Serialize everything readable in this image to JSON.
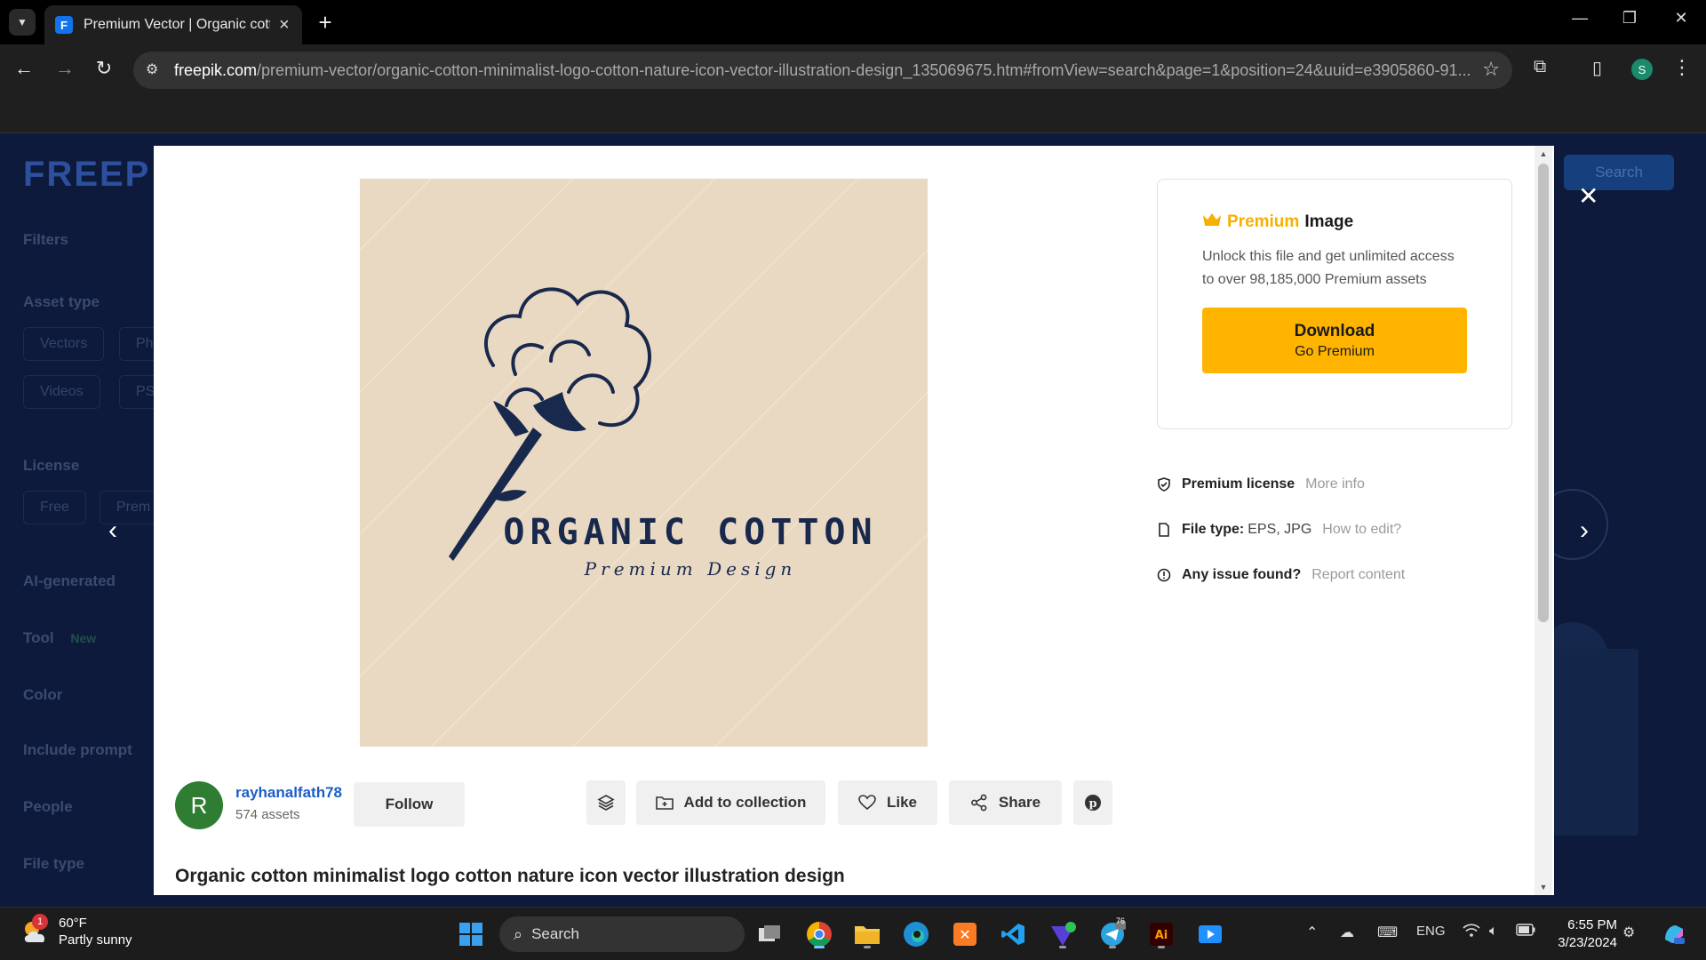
{
  "browser": {
    "tab_title": "Premium Vector | Organic cotto",
    "url_host": "freepik.com",
    "url_path": "/premium-vector/organic-cotton-minimalist-logo-cotton-nature-icon-vector-illustration-design_135069675.htm#fromView=search&page=1&position=24&uuid=e3905860-91...",
    "profile_initial": "S"
  },
  "background_page": {
    "logo": "FREEP",
    "search_label": "Search",
    "filters": "Filters",
    "asset_type": "Asset type",
    "chips_type": [
      "Vectors",
      "Ph",
      "Videos",
      "PS"
    ],
    "license": "License",
    "chips_license": [
      "Free",
      "Prem"
    ],
    "ai_generated": "AI-generated",
    "tool": "Tool",
    "tool_badge": "New",
    "color": "Color",
    "include_prompt": "Include prompt",
    "people": "People",
    "file_type": "File type"
  },
  "preview": {
    "logo_main": "ORGANIC COTTON",
    "logo_sub": "Premium Design"
  },
  "premium_card": {
    "badge": "Premium",
    "label": "Image",
    "description": "Unlock this file and get unlimited access to over 98,185,000 Premium assets",
    "download_title": "Download",
    "download_sub": "Go Premium"
  },
  "info": {
    "license_label": "Premium license",
    "license_link": "More info",
    "filetype_label": "File type:",
    "filetype_value": "EPS, JPG",
    "filetype_link": "How to edit?",
    "issue_label": "Any issue found?",
    "issue_link": "Report content"
  },
  "author": {
    "initial": "R",
    "name": "rayhanalfath78",
    "assets": "574 assets",
    "follow": "Follow"
  },
  "actions": {
    "add_to_collection": "Add to collection",
    "like": "Like",
    "share": "Share"
  },
  "asset_title": "Organic cotton minimalist logo cotton nature icon vector illustration design",
  "taskbar": {
    "temperature": "60°F",
    "condition": "Partly sunny",
    "weather_badge": "1",
    "search_placeholder": "Search",
    "language": "ENG",
    "time": "6:55 PM",
    "date": "3/23/2024",
    "telegram_badge": "76"
  },
  "colors": {
    "accent": "#ffb400",
    "premium_text": "#f6b100",
    "logo_navy": "#18294d",
    "preview_bg": "#ead9c2"
  }
}
